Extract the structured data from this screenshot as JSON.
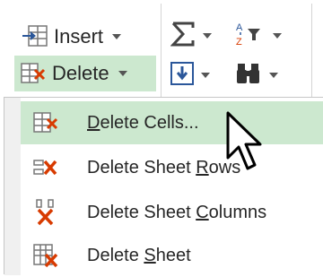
{
  "ribbon": {
    "insert_label": "Insert",
    "delete_label": "Delete",
    "icons": [
      "insert-cells-icon",
      "delete-cells-icon",
      "autosum-icon",
      "sort-filter-icon",
      "fill-down-icon",
      "find-select-icon"
    ]
  },
  "menu": {
    "items": [
      {
        "pre": "",
        "key": "D",
        "post": "elete Cells...",
        "icon": "delete-cells-icon",
        "highlighted": true
      },
      {
        "pre": "Delete Sheet ",
        "key": "R",
        "post": "ows",
        "icon": "delete-sheet-rows-icon",
        "highlighted": false
      },
      {
        "pre": "Delete Sheet ",
        "key": "C",
        "post": "olumns",
        "icon": "delete-sheet-columns-icon",
        "highlighted": false
      },
      {
        "pre": "Delete ",
        "key": "S",
        "post": "heet",
        "icon": "delete-sheet-icon",
        "highlighted": false
      }
    ]
  },
  "colors": {
    "highlight": "#cce8cf",
    "delete_red": "#d83b01",
    "accent_blue": "#2b579a"
  }
}
